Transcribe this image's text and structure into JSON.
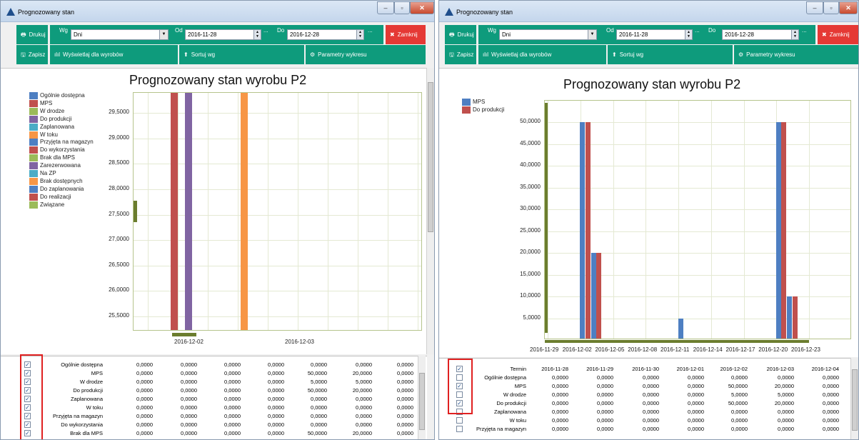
{
  "windows": [
    {
      "title": "Prognozowany stan",
      "toolbar": {
        "print": "Drukuj",
        "group_label": "Wg",
        "group_value": "Dni",
        "from_label": "Od",
        "from_value": "2016-11-28",
        "dots1": "...",
        "to_label": "Do",
        "to_value": "2016-12-28",
        "dots2": "...",
        "close": "Zamknij",
        "save": "Zapisz",
        "show_for": "Wyświetlaj dla wyrobów",
        "sort": "Sortuj wg",
        "chart_params": "Parametry wykresu"
      },
      "chart_data": {
        "type": "bar",
        "title": "Prognozowany stan wyrobu P2",
        "y_ticks": [
          "29,5000",
          "29,0000",
          "28,5000",
          "28,0000",
          "27,5000",
          "27,0000",
          "26,5000",
          "26,0000",
          "25,5000"
        ],
        "x_ticks": [
          "2016-12-02",
          "2016-12-03"
        ],
        "ylim": [
          25.2,
          29.9
        ],
        "legend": [
          {
            "name": "Ogólnie dostępna",
            "color": "#4e7fc2"
          },
          {
            "name": "MPS",
            "color": "#c0504d"
          },
          {
            "name": "W drodze",
            "color": "#9bbb59"
          },
          {
            "name": "Do produkcji",
            "color": "#8064a2"
          },
          {
            "name": "Zaplanowana",
            "color": "#4bacc6"
          },
          {
            "name": "W toku",
            "color": "#f79646"
          },
          {
            "name": "Przyjęta na magazyn",
            "color": "#4e7fc2"
          },
          {
            "name": "Do wykorzystania",
            "color": "#c0504d"
          },
          {
            "name": "Brak dla MPS",
            "color": "#9bbb59"
          },
          {
            "name": "Zarezerwowana",
            "color": "#8064a2"
          },
          {
            "name": "Na ZP",
            "color": "#4bacc6"
          },
          {
            "name": "Brak dostępnych",
            "color": "#f79646"
          },
          {
            "name": "Do zaplanowania",
            "color": "#4e7fc2"
          },
          {
            "name": "Do realizacji",
            "color": "#c0504d"
          },
          {
            "name": "Związane",
            "color": "#9bbb59"
          }
        ],
        "bars": [
          {
            "series": "MPS",
            "x": "2016-12-02",
            "value": 50,
            "color": "#c0504d"
          },
          {
            "series": "Do produkcji",
            "x": "2016-12-02",
            "value": 50,
            "color": "#8064a2"
          },
          {
            "series": "W drodze",
            "x": "2016-12-02",
            "value": 5,
            "color": "#9bbb59"
          },
          {
            "series": "W toku",
            "x": "2016-12-02",
            "value": 50,
            "color": "#f79646"
          }
        ]
      },
      "table": {
        "rows": [
          {
            "checked": true,
            "label": "Ogólnie dostępna",
            "values": [
              "0,0000",
              "0,0000",
              "0,0000",
              "0,0000",
              "0,0000",
              "0,0000",
              "0,0000"
            ]
          },
          {
            "checked": true,
            "label": "MPS",
            "values": [
              "0,0000",
              "0,0000",
              "0,0000",
              "0,0000",
              "50,0000",
              "20,0000",
              "0,0000"
            ]
          },
          {
            "checked": true,
            "label": "W drodze",
            "values": [
              "0,0000",
              "0,0000",
              "0,0000",
              "0,0000",
              "5,0000",
              "5,0000",
              "0,0000"
            ]
          },
          {
            "checked": true,
            "label": "Do produkcji",
            "values": [
              "0,0000",
              "0,0000",
              "0,0000",
              "0,0000",
              "50,0000",
              "20,0000",
              "0,0000"
            ]
          },
          {
            "checked": true,
            "label": "Zaplanowana",
            "values": [
              "0,0000",
              "0,0000",
              "0,0000",
              "0,0000",
              "0,0000",
              "0,0000",
              "0,0000"
            ]
          },
          {
            "checked": true,
            "label": "W toku",
            "values": [
              "0,0000",
              "0,0000",
              "0,0000",
              "0,0000",
              "0,0000",
              "0,0000",
              "0,0000"
            ]
          },
          {
            "checked": true,
            "label": "Przyjęta na magazyn",
            "values": [
              "0,0000",
              "0,0000",
              "0,0000",
              "0,0000",
              "0,0000",
              "0,0000",
              "0,0000"
            ]
          },
          {
            "checked": true,
            "label": "Do wykorzystania",
            "values": [
              "0,0000",
              "0,0000",
              "0,0000",
              "0,0000",
              "0,0000",
              "0,0000",
              "0,0000"
            ]
          },
          {
            "checked": true,
            "label": "Brak dla MPS",
            "values": [
              "0,0000",
              "0,0000",
              "0,0000",
              "0,0000",
              "50,0000",
              "20,0000",
              "0,0000"
            ]
          }
        ]
      }
    },
    {
      "title": "Prognozowany stan",
      "toolbar": {
        "print": "Drukuj",
        "group_label": "Wg",
        "group_value": "Dni",
        "from_label": "Od",
        "from_value": "2016-11-28",
        "dots1": "...",
        "to_label": "Do",
        "to_value": "2016-12-28",
        "dots2": "...",
        "close": "Zamknij",
        "save": "Zapisz",
        "show_for": "Wyświetlaj dla wyrobów",
        "sort": "Sortuj wg",
        "chart_params": "Parametry wykresu"
      },
      "chart_data": {
        "type": "bar",
        "title": "Prognozowany stan wyrobu P2",
        "y_ticks": [
          "50,0000",
          "45,0000",
          "40,0000",
          "35,0000",
          "30,0000",
          "25,0000",
          "20,0000",
          "15,0000",
          "10,0000",
          "5,0000"
        ],
        "x_ticks": [
          "2016-11-29",
          "2016-12-02",
          "2016-12-05",
          "2016-12-08",
          "2016-12-11",
          "2016-12-14",
          "2016-12-17",
          "2016-12-20",
          "2016-12-23"
        ],
        "ylim": [
          0,
          55
        ],
        "legend": [
          {
            "name": "MPS",
            "color": "#4e7fc2"
          },
          {
            "name": "Do produkcji",
            "color": "#c0504d"
          }
        ],
        "series": [
          {
            "name": "MPS",
            "color": "#4e7fc2",
            "points": [
              {
                "x": "2016-12-02",
                "value": 50
              },
              {
                "x": "2016-12-03",
                "value": 20
              },
              {
                "x": "2016-12-11",
                "value": 5
              },
              {
                "x": "2016-12-20",
                "value": 50
              },
              {
                "x": "2016-12-21",
                "value": 10
              }
            ]
          },
          {
            "name": "Do produkcji",
            "color": "#c0504d",
            "points": [
              {
                "x": "2016-12-02",
                "value": 50
              },
              {
                "x": "2016-12-03",
                "value": 20
              },
              {
                "x": "2016-12-20",
                "value": 50
              },
              {
                "x": "2016-12-21",
                "value": 10
              }
            ]
          }
        ]
      },
      "table": {
        "header_label": "Termin",
        "header_checked": true,
        "columns": [
          "2016-11-28",
          "2016-11-29",
          "2016-11-30",
          "2016-12-01",
          "2016-12-02",
          "2016-12-03",
          "2016-12-04"
        ],
        "rows": [
          {
            "checked": false,
            "label": "Ogólnie dostępna",
            "values": [
              "0,0000",
              "0,0000",
              "0,0000",
              "0,0000",
              "0,0000",
              "0,0000",
              "0,0000"
            ]
          },
          {
            "checked": true,
            "label": "MPS",
            "values": [
              "0,0000",
              "0,0000",
              "0,0000",
              "0,0000",
              "50,0000",
              "20,0000",
              "0,0000"
            ]
          },
          {
            "checked": false,
            "label": "W drodze",
            "values": [
              "0,0000",
              "0,0000",
              "0,0000",
              "0,0000",
              "5,0000",
              "5,0000",
              "0,0000"
            ]
          },
          {
            "checked": true,
            "label": "Do produkcji",
            "values": [
              "0,0000",
              "0,0000",
              "0,0000",
              "0,0000",
              "50,0000",
              "20,0000",
              "0,0000"
            ]
          },
          {
            "checked": false,
            "label": "Zaplanowana",
            "values": [
              "0,0000",
              "0,0000",
              "0,0000",
              "0,0000",
              "0,0000",
              "0,0000",
              "0,0000"
            ]
          },
          {
            "checked": false,
            "label": "W toku",
            "values": [
              "0,0000",
              "0,0000",
              "0,0000",
              "0,0000",
              "0,0000",
              "0,0000",
              "0,0000"
            ]
          },
          {
            "checked": false,
            "label": "Przyjęta na magazyn",
            "values": [
              "0,0000",
              "0,0000",
              "0,0000",
              "0,0000",
              "0,0000",
              "0,0000",
              "0,0000"
            ]
          }
        ]
      }
    }
  ]
}
